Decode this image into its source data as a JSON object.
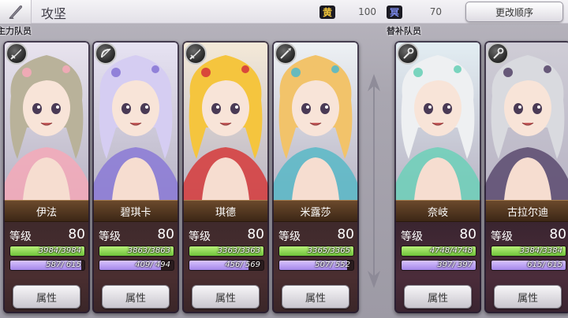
{
  "header": {
    "title": "攻坚",
    "order_button": "更改顺序"
  },
  "resources": [
    {
      "icon": "gold-resource-icon",
      "glyph": "黄",
      "value": "100",
      "color": "#f0c53a"
    },
    {
      "icon": "blue-resource-icon",
      "glyph": "冥",
      "value": "70",
      "color": "#7e8cf0"
    }
  ],
  "sections": {
    "main_label": "主力队员",
    "sub_label": "替补队员"
  },
  "level_label": "等级",
  "attr_button": "属性",
  "members": [
    {
      "name": "伊法",
      "level": "80",
      "hp": "3984/3984",
      "hp_frac": 1.0,
      "mp": "587/ 615",
      "mp_frac": 0.954,
      "weapon": "sword-icon",
      "hair": "#b9b29a",
      "accent": "#f4a9b8",
      "bg": "#e9e4ef"
    },
    {
      "name": "碧琪卡",
      "level": "80",
      "hp": "3863/3863",
      "hp_frac": 1.0,
      "mp": "409/ 494",
      "mp_frac": 0.828,
      "weapon": "bow-icon",
      "hair": "#d5cdf2",
      "accent": "#8a79d6",
      "bg": "#e7e3f3"
    },
    {
      "name": "琪德",
      "level": "80",
      "hp": "3363/3363",
      "hp_frac": 1.0,
      "mp": "456/ 569",
      "mp_frac": 0.801,
      "weapon": "sword-icon",
      "hair": "#f5c53e",
      "accent": "#d63a3a",
      "bg": "#f5ead8"
    },
    {
      "name": "米露莎",
      "level": "80",
      "hp": "3365/3365",
      "hp_frac": 1.0,
      "mp": "507/ 552",
      "mp_frac": 0.918,
      "weapon": "spear-icon",
      "hair": "#f2c36a",
      "accent": "#58b9c7",
      "bg": "#eef2f5"
    },
    {
      "name": "奈岐",
      "level": "80",
      "hp": "4748/4748",
      "hp_frac": 1.0,
      "mp": "397/ 397",
      "mp_frac": 1.0,
      "weapon": "staff-icon",
      "hair": "#eef0f2",
      "accent": "#6cd0b8",
      "bg": "#e3eef3"
    },
    {
      "name": "古拉尔迪",
      "level": "80",
      "hp": "3384/3384",
      "hp_frac": 1.0,
      "mp": "615/ 615",
      "mp_frac": 1.0,
      "weapon": "staff-icon",
      "hair": "#d9dadf",
      "accent": "#5a4a6e",
      "bg": "#cfcdd6"
    }
  ]
}
